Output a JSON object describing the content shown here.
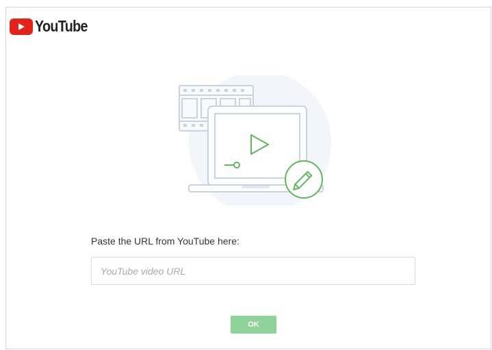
{
  "brand": {
    "logo_text": "YouTube",
    "logo_color": "#e62117"
  },
  "illustration": {
    "description_icon": "video-laptop-edit-illustration",
    "accent_color": "#5cb85c"
  },
  "form": {
    "prompt_label": "Paste the URL from YouTube here:",
    "url_placeholder": "YouTube video URL",
    "url_value": ""
  },
  "actions": {
    "ok_label": "OK",
    "ok_color": "#8ed39a"
  }
}
